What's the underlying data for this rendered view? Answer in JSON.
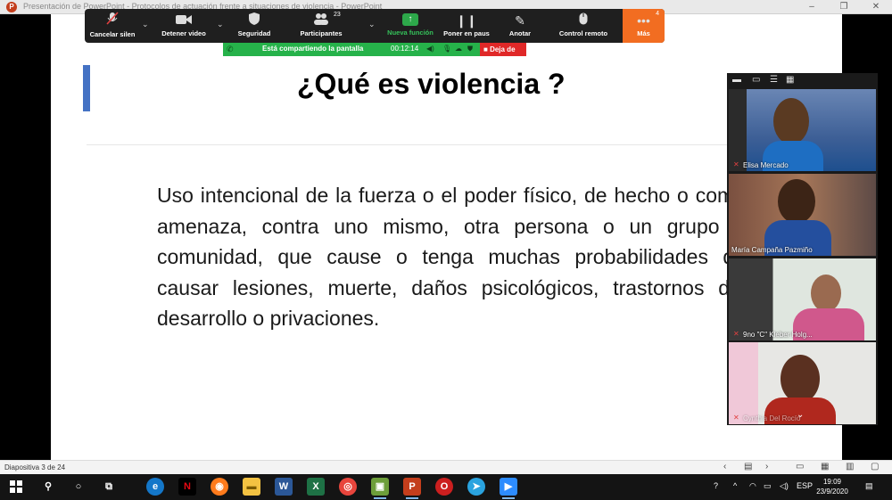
{
  "window": {
    "title": "Presentación de PowerPoint  -  Protocolos de actuación frente a situaciones de violencia - PowerPoint",
    "app_icon": "P",
    "controls": [
      "–",
      "❐",
      "✕"
    ]
  },
  "slide": {
    "heading": "¿Qué es violencia ?",
    "body": "Uso intencional de la fuerza o el poder físico, de hecho o como amenaza, contra uno mismo, otra persona o un grupo o comunidad, que cause o tenga muchas probabilidades de causar lesiones, muerte, daños psicológicos, trastornos del desarrollo o privaciones.",
    "accent_color": "#4472c4"
  },
  "zoom_toolbar": {
    "mute": "Cancelar silen",
    "video": "Detener video",
    "security": "Seguridad",
    "participants": "Participantes",
    "participants_count": "23",
    "new_share": "Nueva función",
    "pause": "Poner en paus",
    "annotate": "Anotar",
    "remote": "Control remoto",
    "more": "Más",
    "more_badge": "4"
  },
  "share_bar": {
    "text": "Está compartiendo la pantalla",
    "timer": "00:12:14",
    "stop_label": "Deja de"
  },
  "gallery": {
    "participants": [
      {
        "name": "Elisa Mercado"
      },
      {
        "name": "María Campaña Pazmiño"
      },
      {
        "name": "9no \"C\" Kleber Holg..."
      },
      {
        "name": "Cynthia Del Rocío"
      }
    ]
  },
  "status_bar": {
    "slide_indicator": "Diapositiva 3 de 24"
  },
  "taskbar": {
    "language": "ESP",
    "time": "19:09",
    "date": "23/9/2020"
  }
}
